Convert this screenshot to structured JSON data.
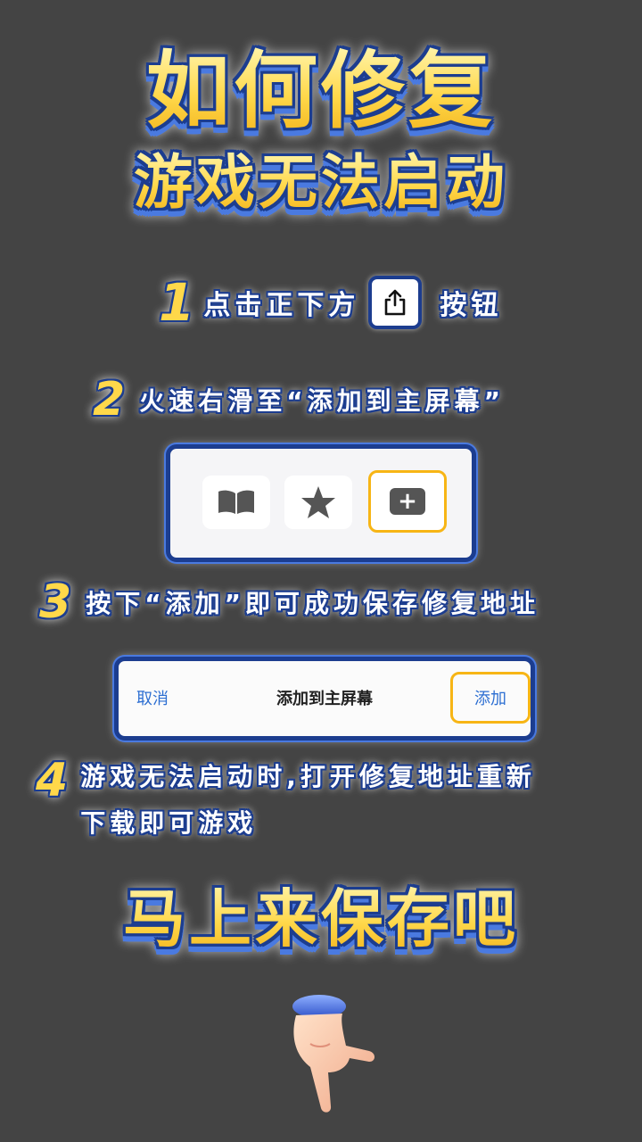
{
  "title": {
    "line1": "如何修复",
    "line2": "游戏无法启动"
  },
  "steps": [
    {
      "num": "1",
      "text_before": "点击正下方",
      "text_after": "按钮"
    },
    {
      "num": "2",
      "text": "火速右滑至“添加到主屏幕”"
    },
    {
      "num": "3",
      "text": "按下“添加”即可成功保存修复地址"
    },
    {
      "num": "4",
      "line1": "游戏无法启动时,打开修复地址重新",
      "line2": "下载即可游戏"
    }
  ],
  "dialog": {
    "cancel": "取消",
    "title": "添加到主屏幕",
    "add": "添加"
  },
  "cta": "马上来保存吧",
  "icons": [
    "share-icon",
    "book-icon",
    "star-icon",
    "add-to-home-icon",
    "pointing-hand-icon"
  ],
  "colors": {
    "background": "#444444",
    "title_gold": "#ffd84a",
    "outline_blue": "#1c3d8f",
    "highlight": "#f7b515",
    "link_blue": "#2d6fd2"
  }
}
